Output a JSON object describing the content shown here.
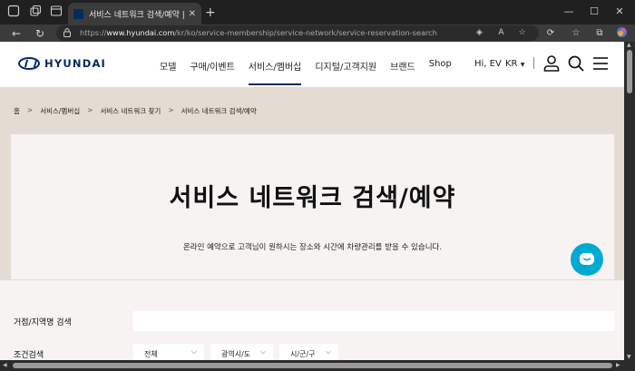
{
  "browser": {
    "tab_title": "서비스 네트워크 검색/예약 | 현대",
    "url_prefix": "https://",
    "url_domain": "www.hyundai.com",
    "url_path": "/kr/ko/service-membership/service-network/service-reservation-search"
  },
  "header": {
    "logo_text": "HYUNDAI",
    "nav": [
      "모델",
      "구매/이벤트",
      "서비스/멤버십",
      "디지털/고객지원",
      "브랜드",
      "Shop"
    ],
    "greeting": "Hi, EV",
    "language": "KR"
  },
  "breadcrumb": [
    "홈",
    "서비스/멤버십",
    "서비스 네트워크 찾기",
    "서비스 네트워크 검색/예약"
  ],
  "hero": {
    "title": "서비스 네트워크 검색/예약",
    "description": "온라인 예약으로 고객님이 원하시는 장소와 시간에 차량관리를 받을 수 있습니다."
  },
  "form": {
    "location_label": "거점/지역명 검색",
    "condition_label": "조건검색",
    "select1": "전체",
    "select2": "광역시/도",
    "select3": "시/군/구"
  },
  "colors": {
    "brand": "#002c5f",
    "chat": "#00aad2",
    "page_bg": "#e4dcd3"
  }
}
